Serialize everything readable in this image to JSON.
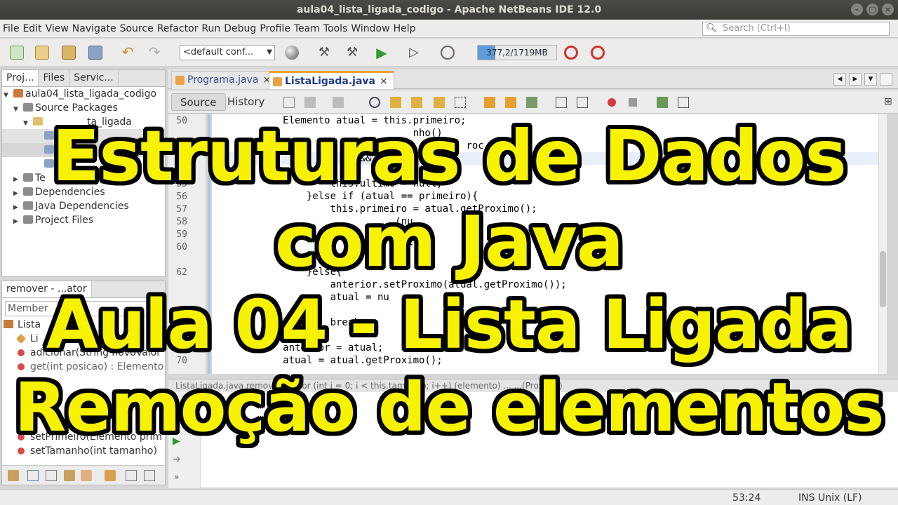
{
  "window": {
    "title": "aula04_lista_ligada_codigo - Apache NetBeans IDE 12.0",
    "buttons": [
      "–",
      "□",
      "×"
    ]
  },
  "menu": {
    "items": [
      "File",
      "Edit",
      "View",
      "Navigate",
      "Source",
      "Refactor",
      "Run",
      "Debug",
      "Profile",
      "Team",
      "Tools",
      "Window",
      "Help"
    ],
    "search_placeholder": "Search (Ctrl+I)"
  },
  "toolbar": {
    "config": "<default conf...",
    "memory_label": "377,2/1719MB",
    "memory_fraction": 0.22
  },
  "projects_panel": {
    "tabs": [
      "Proj...",
      "Files",
      "Servic..."
    ],
    "tree": [
      {
        "label": "aula04_lista_ligada_codigo",
        "icon": "project-icon"
      },
      {
        "label": "Source Packages",
        "icon": "source-packages-icon"
      },
      {
        "label": "ta_ligada",
        "icon": "package-icon"
      },
      {
        "label": "Te",
        "icon": "test-packages-icon"
      },
      {
        "label": "Dependencies",
        "icon": "dependencies-icon"
      },
      {
        "label": "Java Dependencies",
        "icon": "java-dependencies-icon"
      },
      {
        "label": "Project Files",
        "icon": "project-files-icon"
      }
    ]
  },
  "navigator": {
    "tab": "remover - ...ator",
    "member_filter": "Member",
    "items": [
      {
        "label": "Lista"
      },
      {
        "label": "Li"
      },
      {
        "label": "adicionar(String novoValor"
      },
      {
        "label": "get(int posicao) : Elemento"
      },
      {
        "label": "setPrimeiro(Elemento prim"
      },
      {
        "label": "setTamanho(int tamanho)"
      }
    ]
  },
  "editor": {
    "tabs": [
      {
        "label": "Programa.java",
        "active": false
      },
      {
        "label": "ListaLigada.java",
        "active": true
      }
    ],
    "modes": [
      "Source",
      "History"
    ],
    "lines": [
      {
        "no": "50",
        "code": "            Elemento atual = this.primeiro;"
      },
      {
        "no": "",
        "code": "                                  nho()"
      },
      {
        "no": "",
        "code": "                              lsI          roc"
      },
      {
        "no": "",
        "code": "                         &&           ){"
      },
      {
        "no": "",
        "code": "                    i          ull;"
      },
      {
        "no": "55",
        "code": "                    this.ultimo = null;"
      },
      {
        "no": "56",
        "code": "                }else if (atual == primeiro){"
      },
      {
        "no": "57",
        "code": "                    this.primeiro = atual.getProximo();"
      },
      {
        "no": "58",
        "code": "                               (nu"
      },
      {
        "no": "59",
        "code": "                               lti"
      },
      {
        "no": "60",
        "code": "                               ter"
      },
      {
        "no": "",
        "code": "                               i"
      },
      {
        "no": "62",
        "code": "                }else{"
      },
      {
        "no": "",
        "code": "                    anterior.setProximo(atual.getProximo());"
      },
      {
        "no": "",
        "code": "                    atual = nu"
      },
      {
        "no": "",
        "code": "                                 no-"
      },
      {
        "no": "",
        "code": "                    break;"
      },
      {
        "no": "68",
        "code": "                }"
      },
      {
        "no": "69",
        "code": "            anterior = atual;"
      },
      {
        "no": "70",
        "code": "            atual = atual.getProximo();"
      }
    ]
  },
  "output": {
    "tab_text": "ListaLigada.java    remover(...)     for (int i = 0; i < this.tamanho; i++)  (elemento)  ...    ...(Proximo)"
  },
  "statusbar": {
    "position": "53:24",
    "mode": "INS",
    "line_ending": "Unix (LF)"
  },
  "overlay": {
    "lines": [
      "Estruturas de Dados",
      "com Java",
      "Aula 04 - Lista Ligada",
      "Remoção de elementos"
    ]
  }
}
